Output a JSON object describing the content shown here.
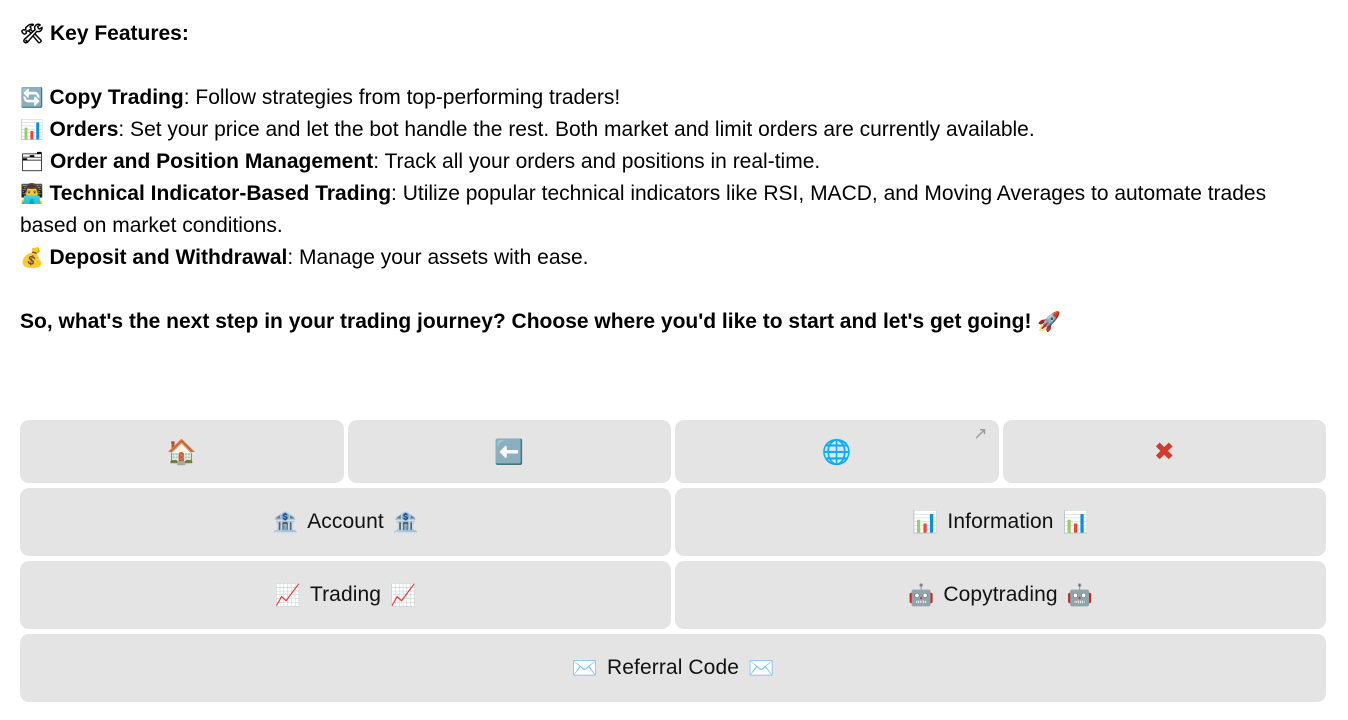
{
  "message": {
    "heading": {
      "emoji": "🛠",
      "text": "Key Features:"
    },
    "features": [
      {
        "emoji": "🔄",
        "title": "Copy Trading",
        "body": ": Follow strategies from top-performing traders!"
      },
      {
        "emoji": "📊",
        "title": "Orders",
        "body": ": Set your price and let the bot handle the rest. Both market and limit orders are currently available."
      },
      {
        "emoji": "🗂",
        "title": "Order and Position Management",
        "body": ": Track all your orders and positions in real-time."
      },
      {
        "emoji": "👨‍💻",
        "title": "Technical Indicator-Based Trading",
        "body": ": Utilize popular technical indicators like RSI, MACD, and Moving Averages to automate trades based on market conditions."
      },
      {
        "emoji": "💰",
        "title": "Deposit and Withdrawal",
        "body": ": Manage your assets with ease."
      }
    ],
    "cta": {
      "text": "So, what's the next step in your trading journey? Choose where you'd like to start and let's get going!",
      "emoji": "🚀"
    }
  },
  "keyboard": {
    "rows": [
      {
        "buttons": [
          {
            "icon": "🏠",
            "icon_name": "home-icon",
            "label": "",
            "name": "keyboard-button-home"
          },
          {
            "icon": "⬅️",
            "icon_name": "back-arrow-icon",
            "label": "",
            "name": "keyboard-button-back"
          },
          {
            "icon": "🌐",
            "icon_name": "globe-icon",
            "label": "",
            "name": "keyboard-button-website",
            "external": "↗"
          },
          {
            "icon": "✖",
            "icon_name": "close-x-icon",
            "label": "",
            "name": "keyboard-button-close"
          }
        ]
      },
      {
        "buttons": [
          {
            "icon": "🏦",
            "icon_name": "bank-icon",
            "label": "Account",
            "name": "keyboard-button-account"
          },
          {
            "icon": "📊",
            "icon_name": "bar-chart-icon",
            "label": "Information",
            "name": "keyboard-button-information"
          }
        ]
      },
      {
        "buttons": [
          {
            "icon": "📈",
            "icon_name": "chart-increasing-icon",
            "label": "Trading",
            "name": "keyboard-button-trading"
          },
          {
            "icon": "🤖",
            "icon_name": "robot-icon",
            "label": "Copytrading",
            "name": "keyboard-button-copytrading"
          }
        ]
      },
      {
        "buttons": [
          {
            "icon": "✉️",
            "icon_name": "envelope-icon",
            "label": "Referral Code",
            "name": "keyboard-button-referral-code"
          }
        ]
      }
    ]
  },
  "colors": {
    "button_bg": "#e4e4e4",
    "page_bg": "#ffffff",
    "text": "#000000",
    "close_red": "#d23c2e",
    "external_arrow": "#9a9a9a"
  }
}
